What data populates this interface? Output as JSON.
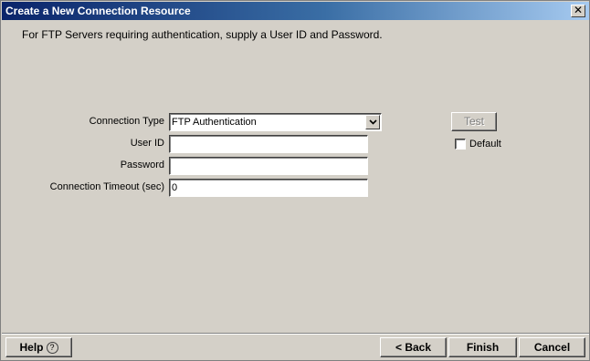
{
  "window": {
    "title": "Create a New Connection Resource",
    "close_glyph": "✕"
  },
  "instruction": "For FTP Servers requiring authentication, supply a User ID and Password.",
  "form": {
    "connection_type_label": "Connection Type",
    "connection_type_value": "FTP Authentication",
    "user_id_label": "User ID",
    "user_id_value": "",
    "password_label": "Password",
    "password_value": "",
    "timeout_label": "Connection Timeout (sec)",
    "timeout_value": "0"
  },
  "side": {
    "test_label": "Test",
    "default_label": "Default",
    "default_checked": false
  },
  "footer": {
    "help_label": "Help",
    "help_icon": "?",
    "back_label": "< Back",
    "finish_label": "Finish",
    "cancel_label": "Cancel"
  },
  "colors": {
    "titlebar_start": "#0a246a",
    "titlebar_end": "#a6caf0",
    "dialog_bg": "#d4d0c8"
  }
}
